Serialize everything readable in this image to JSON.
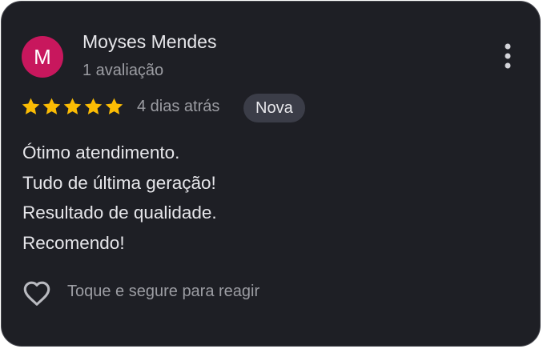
{
  "review": {
    "author": {
      "initial": "M",
      "name": "Moyses Mendes",
      "review_count": "1 avaliação",
      "avatar_color": "#c8175d"
    },
    "rating": 5,
    "max_rating": 5,
    "star_color": "#fbbc04",
    "date": "4 dias atrás",
    "badge": "Nova",
    "text_lines": [
      "Ótimo atendimento.",
      "Tudo de última geração!",
      "Resultado de qualidade.",
      "Recomendo!"
    ],
    "reaction_hint": "Toque e segure para reagir",
    "icons": {
      "more": "more-vert-icon",
      "star": "star-icon",
      "react": "heart-outline-icon"
    }
  },
  "colors": {
    "card_background": "#1e1f25",
    "primary_text": "#e6e6ea",
    "secondary_text": "#9c9da3",
    "badge_background": "#3b3d48"
  }
}
